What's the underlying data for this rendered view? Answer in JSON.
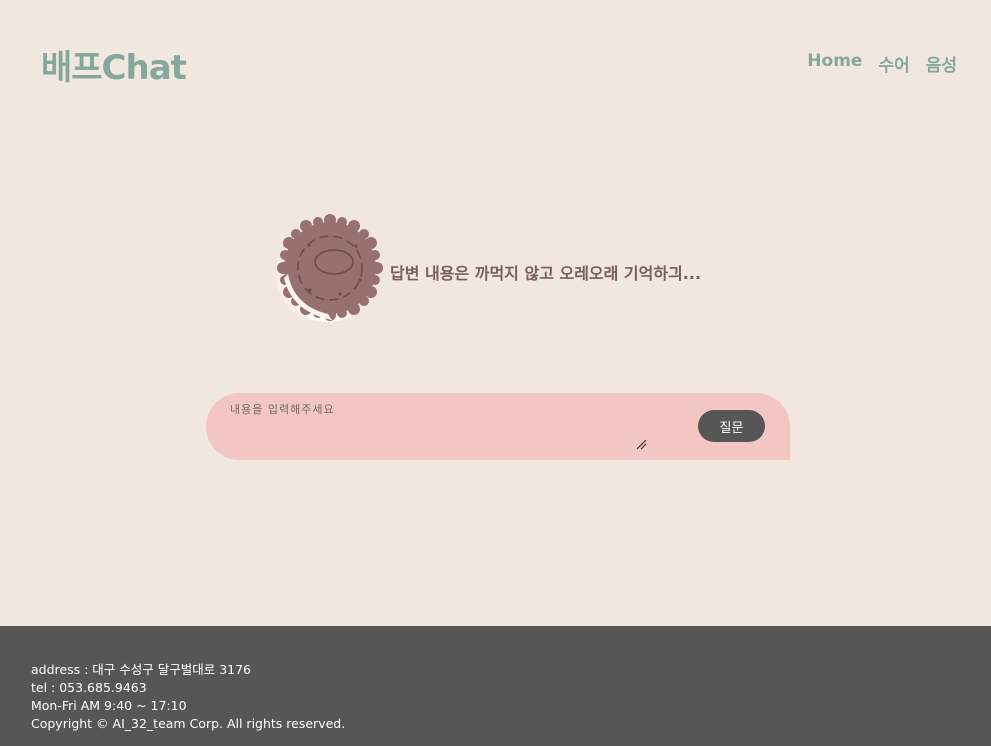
{
  "header": {
    "logo": "배프Chat",
    "nav": [
      "Home",
      "수어",
      "음성"
    ]
  },
  "answer": {
    "icon": "cookie-icon",
    "text": "답변 내용은 까먹지 않고 오레오래 기억하긔..."
  },
  "question": {
    "placeholder": "내용을 입력해주세요",
    "value": "",
    "submit_label": "질문"
  },
  "footer": {
    "address": "address : 대구 수성구 달구벌대로 3176",
    "tel": "tel : 053.685.9463",
    "hours": "Mon-Fri AM 9:40 ~ 17:10",
    "copyright": "Copyright © AI_32_team Corp. All rights reserved."
  },
  "colors": {
    "background": "#f2e7df",
    "accent": "#85a89d",
    "input_bg": "#f2c6c3",
    "button_bg": "#565656",
    "footer_bg": "#565656",
    "answer_text": "#7b5c5c"
  }
}
